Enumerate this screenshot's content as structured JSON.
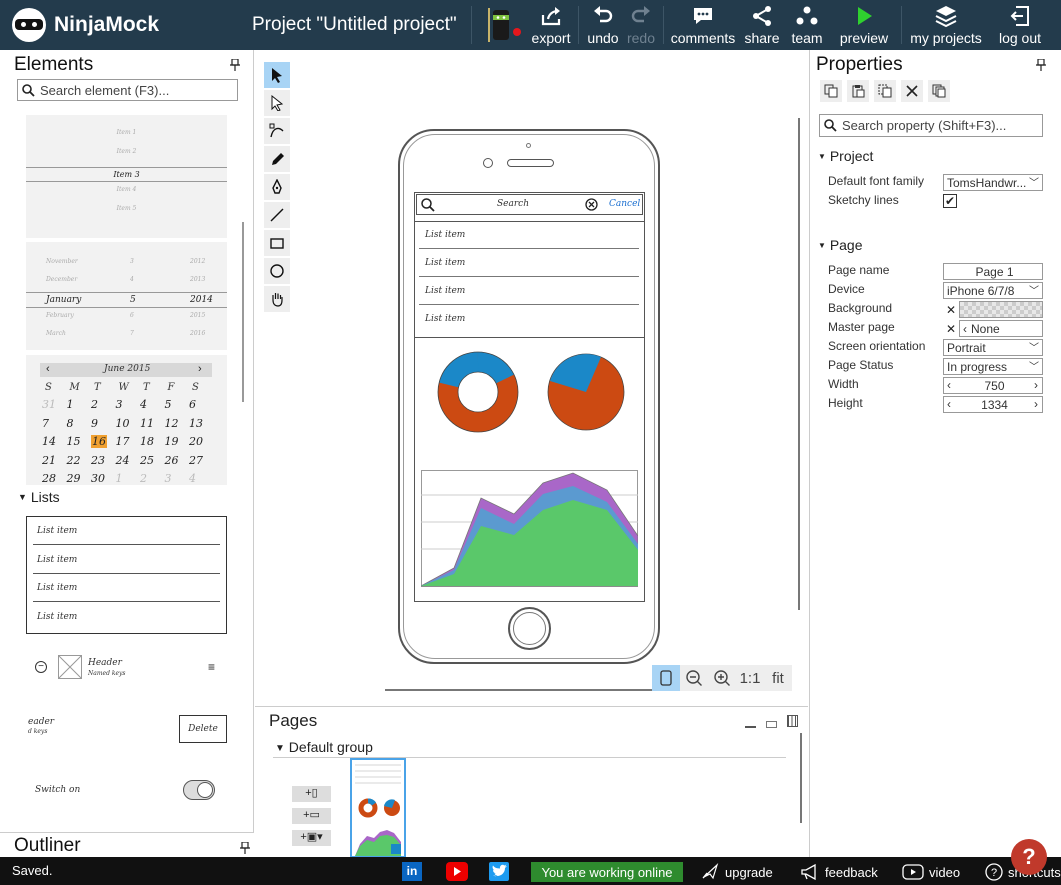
{
  "app": {
    "brand": "NinjaMock",
    "project_title": "Project \"Untitled project\""
  },
  "toolbar": {
    "export": "export",
    "undo": "undo",
    "redo": "redo",
    "comments": "comments",
    "share": "share",
    "team": "team",
    "preview": "preview",
    "my_projects": "my projects",
    "log_out": "log out"
  },
  "elements_panel": {
    "title": "Elements",
    "search_placeholder": "Search element (F3)...",
    "picker_items": [
      "Item 1",
      "Item 2",
      "Item 3",
      "Item 4",
      "Item 5"
    ],
    "date_rows": [
      {
        "m": "November",
        "d": "3",
        "y": "2012"
      },
      {
        "m": "December",
        "d": "4",
        "y": "2013"
      },
      {
        "m": "January",
        "d": "5",
        "y": "2014"
      },
      {
        "m": "February",
        "d": "6",
        "y": "2015"
      },
      {
        "m": "March",
        "d": "7",
        "y": "2016"
      }
    ],
    "calendar": {
      "month": "June 2015",
      "weekdays": [
        "S",
        "M",
        "T",
        "W",
        "T",
        "F",
        "S"
      ],
      "days": [
        "31",
        "1",
        "2",
        "3",
        "4",
        "5",
        "6",
        "7",
        "8",
        "9",
        "10",
        "11",
        "12",
        "13",
        "14",
        "15",
        "16",
        "17",
        "18",
        "19",
        "20",
        "21",
        "22",
        "23",
        "24",
        "25",
        "26",
        "27",
        "28",
        "29",
        "30",
        "1",
        "2",
        "3",
        "4"
      ],
      "today": "16"
    },
    "lists_section": "Lists",
    "list_items": [
      "List item",
      "List item",
      "List item",
      "List item"
    ],
    "header_item": {
      "title": "Header",
      "sub": "Named keys"
    },
    "delete_item": {
      "title": "eader",
      "sub": "d keys",
      "button": "Delete"
    },
    "switch_label": "Switch on"
  },
  "outliner": {
    "title": "Outliner"
  },
  "canvas": {
    "search_text": "Search",
    "cancel_text": "Cancel",
    "list_items": [
      "List item",
      "List item",
      "List item",
      "List item"
    ],
    "zoom_one": "1:1",
    "zoom_fit": "fit"
  },
  "pages": {
    "title": "Pages",
    "group": "Default group"
  },
  "properties": {
    "title": "Properties",
    "search_placeholder": "Search property (Shift+F3)...",
    "project_section": "Project",
    "default_font_label": "Default font family",
    "default_font_value": "TomsHandwr...",
    "sketchy_label": "Sketchy lines",
    "sketchy_checked": true,
    "page_section": "Page",
    "page_name_label": "Page name",
    "page_name_value": "Page 1",
    "device_label": "Device",
    "device_value": "iPhone 6/7/8",
    "background_label": "Background",
    "master_label": "Master page",
    "master_value": "None",
    "orientation_label": "Screen orientation",
    "orientation_value": "Portrait",
    "status_label": "Page Status",
    "status_value": "In progress",
    "width_label": "Width",
    "width_value": "750",
    "height_label": "Height",
    "height_value": "1334"
  },
  "status_bar": {
    "saved": "Saved.",
    "online": "You are working online",
    "upgrade": "upgrade",
    "feedback": "feedback",
    "video": "video",
    "shortcuts": "shortcuts"
  },
  "colors": {
    "topbar": "#233b4c",
    "donut_blue": "#1b88c8",
    "donut_orange": "#cc4a12",
    "area_green": "#5ac86a",
    "area_blue": "#5b9ad0",
    "area_purple": "#a967c8",
    "online_green": "#2e8b2e",
    "help_red": "#c0392b"
  }
}
